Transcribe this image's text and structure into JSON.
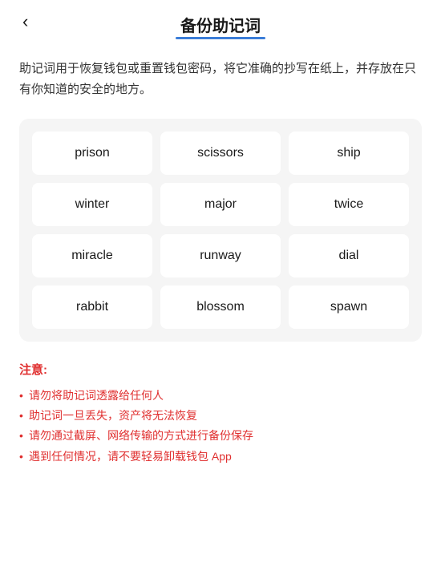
{
  "header": {
    "back_label": "‹",
    "title": "备份助记词"
  },
  "description": {
    "text": "助记词用于恢复钱包或重置钱包密码，将它准确的抄写在纸上，并存放在只有你知道的安全的地方。"
  },
  "mnemonic_grid": {
    "words": [
      "prison",
      "scissors",
      "ship",
      "winter",
      "major",
      "twice",
      "miracle",
      "runway",
      "dial",
      "rabbit",
      "blossom",
      "spawn"
    ]
  },
  "notice": {
    "title": "注意:",
    "items": [
      "请勿将助记词透露给任何人",
      "助记词一旦丢失，资产将无法恢复",
      "请勿通过截屏、网络传输的方式进行备份保存",
      "遇到任何情况，请不要轻易卸载钱包 App"
    ]
  }
}
